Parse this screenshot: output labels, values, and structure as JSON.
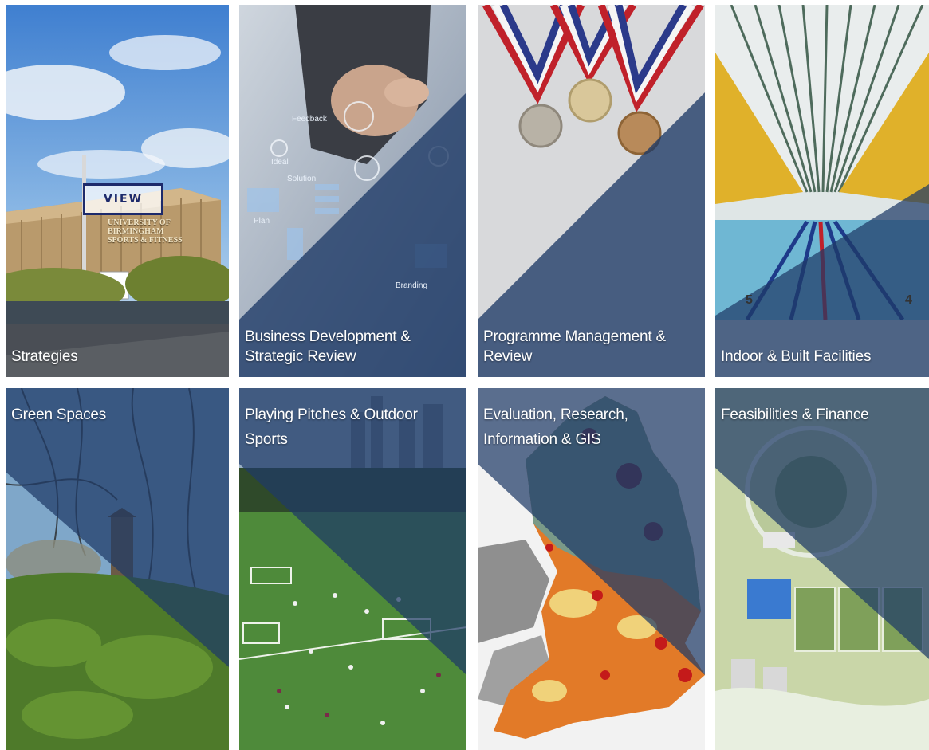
{
  "tiles": [
    {
      "id": "strategies",
      "label": [
        "Strategies"
      ],
      "pos": "bottom"
    },
    {
      "id": "business",
      "label": [
        "Business Development &",
        "Strategic Review"
      ],
      "pos": "bottom"
    },
    {
      "id": "programme",
      "label": [
        "Programme Management &",
        "Review"
      ],
      "pos": "bottom"
    },
    {
      "id": "indoor",
      "label": [
        "Indoor & Built Facilities"
      ],
      "pos": "bottom"
    },
    {
      "id": "green",
      "label": [
        "Green Spaces"
      ],
      "pos": "top"
    },
    {
      "id": "pitches",
      "label": [
        "Playing Pitches & Outdoor",
        "Sports"
      ],
      "pos": "top"
    },
    {
      "id": "evaluation",
      "label": [
        "Evaluation, Research,",
        "Information & GIS"
      ],
      "pos": "top"
    },
    {
      "id": "feasibilities",
      "label": [
        "Feasibilities & Finance"
      ],
      "pos": "top"
    }
  ],
  "view_button": {
    "label": "VIEW"
  },
  "sign_text": [
    "UNIVERSITY OF",
    "BIRMINGHAM",
    "SPORTS & FITNESS"
  ],
  "whiteboard_words": [
    "Feedback",
    "Ideal",
    "Solution",
    "Branding",
    "Plan"
  ],
  "lane_numbers": [
    "5",
    "4"
  ],
  "colors": {
    "overlay": "#1e3a66",
    "view_border": "#1d2a6b"
  }
}
